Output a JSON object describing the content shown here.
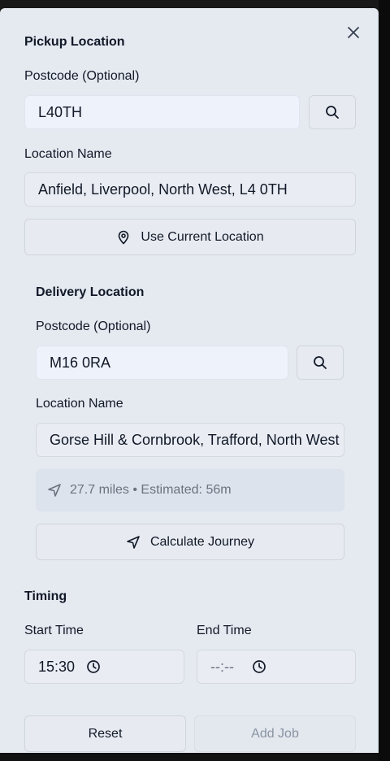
{
  "pickup": {
    "title": "Pickup Location",
    "postcode_label": "Postcode (Optional)",
    "postcode_value": "L40TH",
    "location_label": "Location Name",
    "location_value": "Anfield, Liverpool, North West, L4 0TH",
    "use_current_label": "Use Current Location"
  },
  "delivery": {
    "title": "Delivery Location",
    "postcode_label": "Postcode (Optional)",
    "postcode_value": "M16 0RA",
    "location_label": "Location Name",
    "location_value": "Gorse Hill & Cornbrook, Trafford, North West",
    "journey_info": "27.7 miles • Estimated: 56m",
    "calculate_label": "Calculate Journey"
  },
  "timing": {
    "title": "Timing",
    "start_label": "Start Time",
    "start_value": "15:30",
    "end_label": "End Time",
    "end_value": "--:--"
  },
  "actions": {
    "reset_label": "Reset",
    "add_label": "Add Job"
  },
  "icons": {
    "close": "close-icon",
    "search": "search-icon",
    "pin": "map-pin-icon",
    "navigation": "navigation-icon",
    "clock": "clock-icon"
  },
  "colors": {
    "panel_bg": "#e5e9f0",
    "input_filled_bg": "#eef2fb",
    "muted_text": "#6b7280"
  }
}
